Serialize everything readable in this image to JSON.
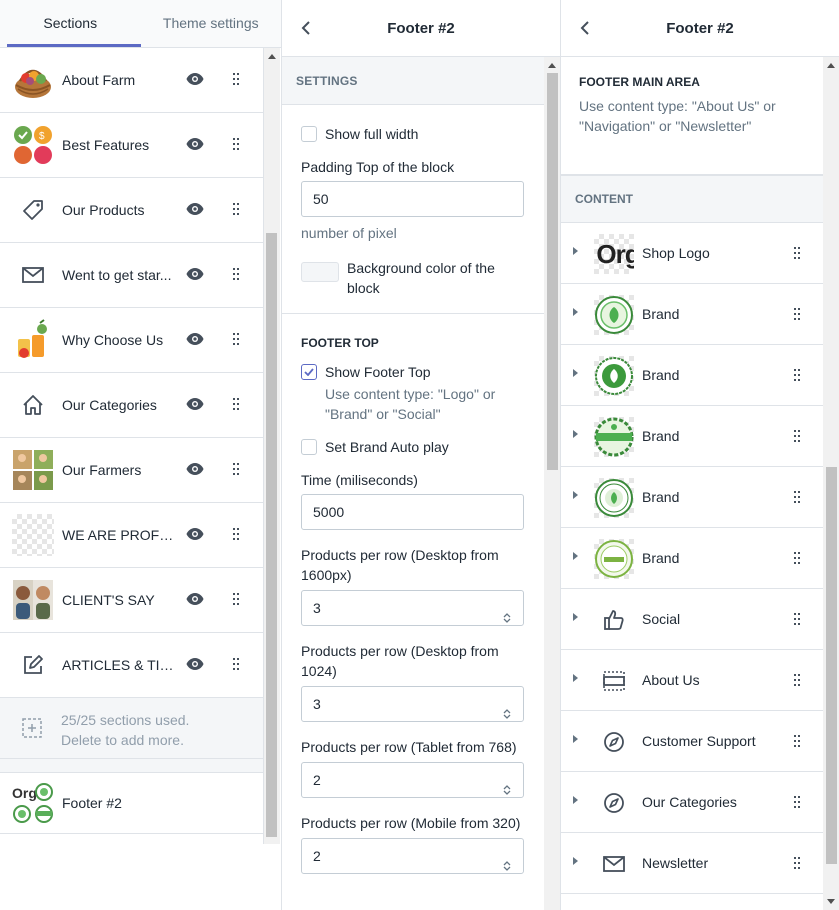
{
  "sections_panel": {
    "tabs": [
      {
        "label": "Sections",
        "active": true
      },
      {
        "label": "Theme settings",
        "active": false
      }
    ],
    "items": [
      {
        "label": "About Farm",
        "thumb": "basket-image"
      },
      {
        "label": "Best Features",
        "thumb": "features-image"
      },
      {
        "label": "Our Products",
        "thumb": "tag-icon"
      },
      {
        "label": "Went to get star...",
        "thumb": "mail-icon"
      },
      {
        "label": "Why Choose Us",
        "thumb": "fruit-image"
      },
      {
        "label": "Our Categories",
        "thumb": "home-icon"
      },
      {
        "label": "Our Farmers",
        "thumb": "farmers-image"
      },
      {
        "label": "WE ARE PROFES...",
        "thumb": "placeholder-image"
      },
      {
        "label": "CLIENT'S SAY",
        "thumb": "clients-image"
      },
      {
        "label": "ARTICLES & TIPS",
        "thumb": "edit-icon"
      }
    ],
    "usage_line1": "25/25 sections used.",
    "usage_line2": "Delete to add more.",
    "footer_item": {
      "label": "Footer #2"
    }
  },
  "settings_panel": {
    "title": "Footer #2",
    "settings_header": "SETTINGS",
    "show_full_width": {
      "label": "Show full width",
      "checked": false
    },
    "padding_top": {
      "label": "Padding Top of the block",
      "value": "50",
      "help": "number of pixel"
    },
    "bg_color": {
      "label_line1": "Background color of the",
      "label_line2": "block",
      "value": "#f4f6f8"
    },
    "footer_top_header": "FOOTER TOP",
    "show_footer_top": {
      "label": "Show Footer Top",
      "checked": true,
      "help_line1": "Use content type: \"Logo\" or",
      "help_line2": "\"Brand\" or \"Social\""
    },
    "brand_autoplay": {
      "label": "Set Brand Auto play",
      "checked": false
    },
    "time": {
      "label": "Time (miliseconds)",
      "value": "5000"
    },
    "per_row_1600": {
      "label_line1": "Products per row (Desktop from",
      "label_line2": "1600px)",
      "value": "3"
    },
    "per_row_1024": {
      "label_line1": "Products per row (Desktop from",
      "label_line2": "1024)",
      "value": "3"
    },
    "per_row_768": {
      "label": "Products per row (Tablet from 768)",
      "value": "2"
    },
    "per_row_320": {
      "label": "Products per row (Mobile from 320)",
      "value": "2"
    }
  },
  "blocks_panel": {
    "title": "Footer #2",
    "main_area_title": "FOOTER MAIN AREA",
    "main_area_desc_line1": "Use content type: \"About Us\" or",
    "main_area_desc_line2": "\"Navigation\" or \"Newsletter\"",
    "content_header": "CONTENT",
    "blocks": [
      {
        "label": "Shop Logo",
        "thumb": "logo-image",
        "logo_text": "Org"
      },
      {
        "label": "Brand",
        "thumb": "brand-badge"
      },
      {
        "label": "Brand",
        "thumb": "brand-badge"
      },
      {
        "label": "Brand",
        "thumb": "brand-badge"
      },
      {
        "label": "Brand",
        "thumb": "brand-badge"
      },
      {
        "label": "Brand",
        "thumb": "brand-badge"
      },
      {
        "label": "Social",
        "thumb": "thumbs-up-icon"
      },
      {
        "label": "About Us",
        "thumb": "layout-icon"
      },
      {
        "label": "Customer Support",
        "thumb": "compass-icon"
      },
      {
        "label": "Our Categories",
        "thumb": "compass-icon"
      },
      {
        "label": "Newsletter",
        "thumb": "mail-icon"
      }
    ]
  },
  "colors": {
    "accent": "#5c6ac4",
    "text": "#212b36",
    "muted": "#637381",
    "border": "#dfe3e8",
    "panel_bg": "#f4f6f8",
    "brand_green": "#3a8a3a"
  }
}
